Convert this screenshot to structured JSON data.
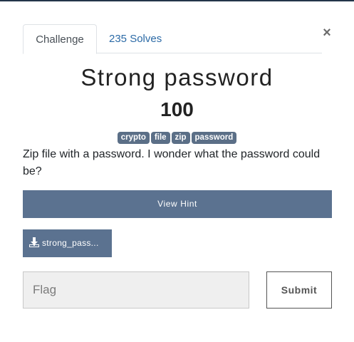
{
  "tabs": [
    {
      "label": "Challenge",
      "active": true
    },
    {
      "label": "235 Solves",
      "active": false
    }
  ],
  "close_label": "×",
  "challenge": {
    "name": "Strong password",
    "value": "100",
    "tags": [
      "crypto",
      "file",
      "zip",
      "password"
    ],
    "description": "Zip file with a password. I wonder what the password could be?"
  },
  "hint_button_label": "View Hint",
  "file": {
    "label": "strong_pass..."
  },
  "flag_input": {
    "placeholder": "Flag",
    "value": ""
  },
  "submit_label": "Submit",
  "colors": {
    "accent": "#5b7290",
    "tag": "#5b6f87",
    "link": "#2b6aa6"
  }
}
